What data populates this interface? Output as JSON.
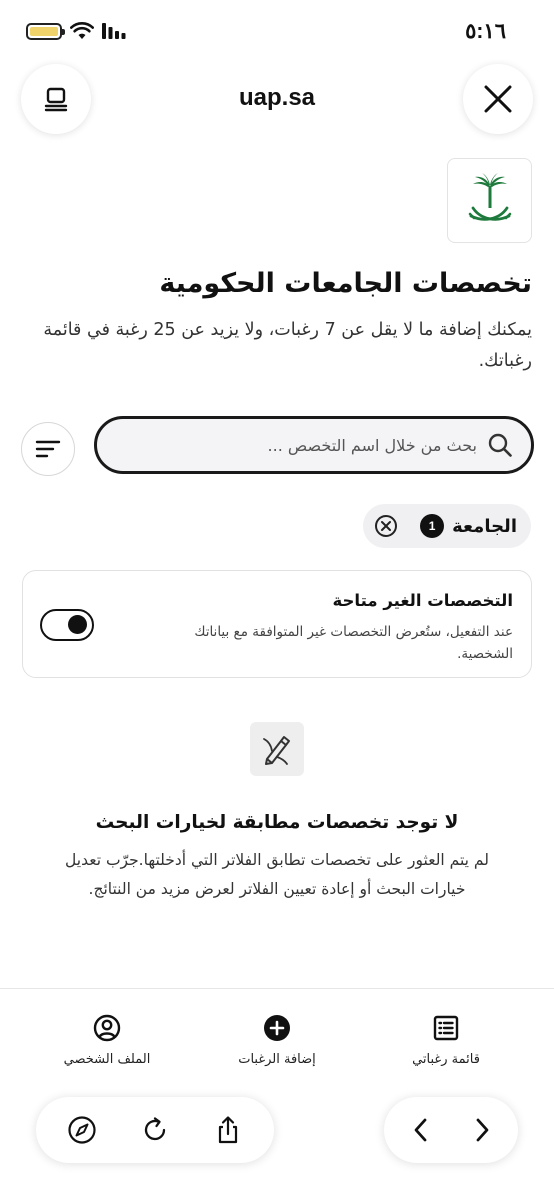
{
  "status_bar": {
    "time": "٥:١٦",
    "icons": [
      "battery-icon",
      "wifi-icon",
      "signal-icon"
    ]
  },
  "browser": {
    "url": "uap.sa",
    "icons": {
      "tabs": "tabs-icon",
      "close": "close-icon"
    }
  },
  "header": {
    "logo": "saudi-emblem-icon",
    "title": "تخصصات الجامعات الحكومية",
    "subtitle": "يمكنك إضافة ما لا يقل عن 7 رغبات، ولا يزيد عن 25 رغبة في قائمة رغباتك."
  },
  "search": {
    "placeholder": "بحث من خلال اسم التخصص ...",
    "value": ""
  },
  "active_filters": [
    {
      "label": "الجامعة",
      "count": "1"
    }
  ],
  "unavailable_toggle": {
    "title": "التخصصات الغير متاحة",
    "description": "عند التفعيل، ستُعرض التخصصات غير المتوافقة مع بياناتك الشخصية.",
    "enabled": true
  },
  "empty_state": {
    "icon": "edit-pen-icon",
    "title": "لا توجد تخصصات مطابقة لخيارات البحث",
    "description": "لم يتم العثور على تخصصات تطابق الفلاتر التي أدخلتها.جرّب تعديل خيارات البحث أو إعادة تعيين الفلاتر لعرض مزيد من النتائج."
  },
  "bottom_nav": {
    "items": [
      {
        "label": "الملف الشخصي",
        "icon": "profile-icon"
      },
      {
        "label": "إضافة الرغبات",
        "icon": "add-circle-icon"
      },
      {
        "label": "قائمة رغباتي",
        "icon": "list-icon"
      }
    ]
  },
  "colors": {
    "text": "#111111",
    "emblem_green": "#1e7a3c",
    "chip_bg": "#f0f0f2",
    "search_bg": "#f4f4f6"
  }
}
